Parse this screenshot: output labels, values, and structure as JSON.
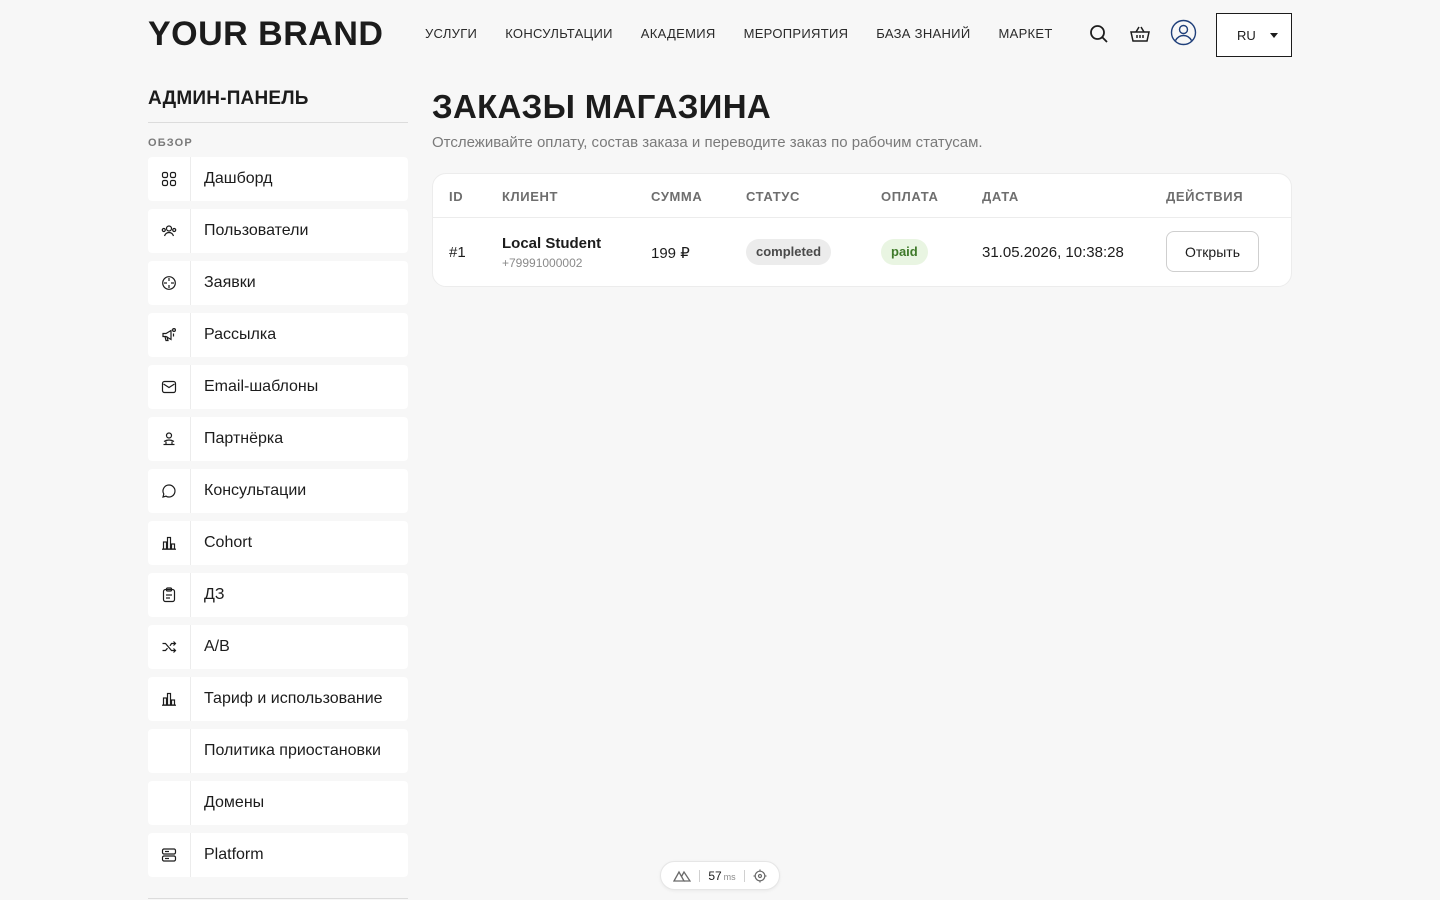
{
  "header": {
    "brand": "YOUR BRAND",
    "nav": [
      "УСЛУГИ",
      "КОНСУЛЬТАЦИИ",
      "АКАДЕМИЯ",
      "МЕРОПРИЯТИЯ",
      "БАЗА ЗНАНИЙ",
      "МАРКЕТ"
    ],
    "icons": [
      "search-icon",
      "basket-icon",
      "user-icon"
    ],
    "language": "RU"
  },
  "sidebar": {
    "title": "АДМИН-ПАНЕЛЬ",
    "section": "ОБЗОР",
    "items": [
      {
        "label": "Дашборд",
        "icon": "dashboard-icon"
      },
      {
        "label": "Пользователи",
        "icon": "users-icon"
      },
      {
        "label": "Заявки",
        "icon": "target-icon"
      },
      {
        "label": "Рассылка",
        "icon": "megaphone-icon"
      },
      {
        "label": "Email-шаблоны",
        "icon": "mail-icon"
      },
      {
        "label": "Партнёрка",
        "icon": "partner-icon"
      },
      {
        "label": "Консультации",
        "icon": "chat-icon"
      },
      {
        "label": "Cohort",
        "icon": "bar-chart-icon"
      },
      {
        "label": "ДЗ",
        "icon": "clipboard-icon"
      },
      {
        "label": "A/B",
        "icon": "shuffle-icon"
      },
      {
        "label": "Тариф и использование",
        "icon": "bar-chart-icon"
      },
      {
        "label": "Политика приостановки",
        "icon": ""
      },
      {
        "label": "Домены",
        "icon": ""
      },
      {
        "label": "Platform",
        "icon": "server-icon"
      }
    ]
  },
  "main": {
    "title": "ЗАКАЗЫ МАГАЗИНА",
    "subtitle": "Отслеживайте оплату, состав заказа и переводите заказ по рабочим статусам.",
    "columns": [
      "ID",
      "КЛИЕНТ",
      "СУММА",
      "СТАТУС",
      "ОПЛАТА",
      "ДАТА",
      "ДЕЙСТВИЯ"
    ],
    "rows": [
      {
        "id": "#1",
        "client_name": "Local Student",
        "client_phone": "+79991000002",
        "amount": "199 ₽",
        "status": "completed",
        "payment": "paid",
        "date": "31.05.2026, 10:38:28",
        "action": "Открыть"
      }
    ]
  },
  "devtools": {
    "ms_value": "57",
    "ms_unit": "ms"
  },
  "colors": {
    "background": "#f7f7f7",
    "paid_badge_bg": "#e9f5e2",
    "paid_badge_text": "#3f7a2a",
    "status_badge_bg": "#ececec"
  }
}
